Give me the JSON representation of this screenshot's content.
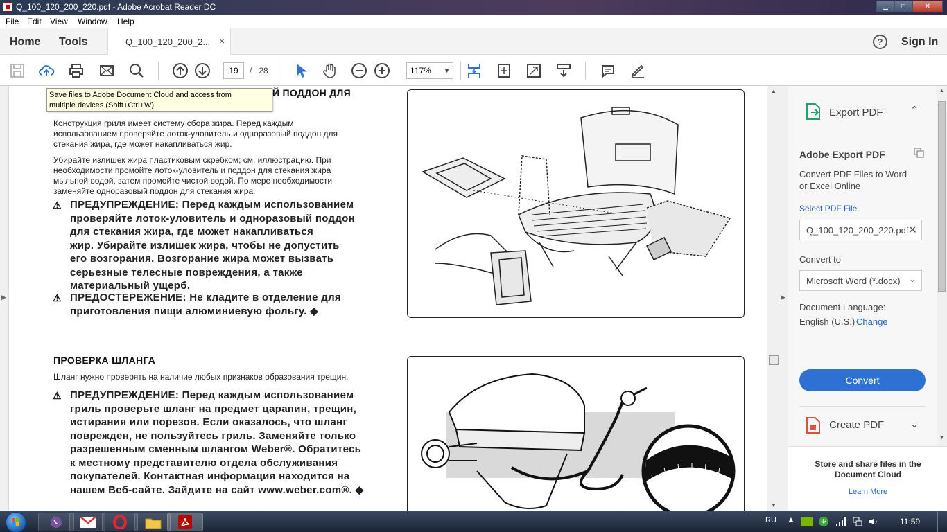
{
  "window": {
    "title": "Q_100_120_200_220.pdf - Adobe Acrobat Reader DC",
    "min": "▁",
    "max": "□",
    "close": "✕"
  },
  "menu": [
    "File",
    "Edit",
    "View",
    "Window",
    "Help"
  ],
  "tabs": {
    "home": "Home",
    "tools": "Tools",
    "document": "Q_100_120_200_2...",
    "close": "×"
  },
  "header": {
    "help": "?",
    "sign_in": "Sign In"
  },
  "toolbar": {
    "page_current": "19",
    "page_sep": "/",
    "page_total": "28",
    "zoom": "117%"
  },
  "tooltip": {
    "line1": "Save files to Adobe Document Cloud and access from",
    "line2": "multiple devices (Shift+Ctrl+W)"
  },
  "doc": {
    "section1": {
      "heading": "Й ПОДДОН ДЛЯ",
      "para1": [
        "Конструкция гриля имеет систему сбора жира. Перед каждым",
        "использованием проверяйте лоток-уловитель и одноразовый поддон для",
        "стекания жира, где может накапливаться жир."
      ],
      "para2": [
        "Убирайте излишек жира пластиковым скребком; см. иллюстрацию. При",
        "необходимости промойте лоток-уловитель и поддон для стекания жира",
        "мыльной водой, затем промойте чистой водой. По мере необходимости",
        "заменяйте одноразовый поддон для стекания жира."
      ],
      "warning": [
        "ПРЕДУПРЕЖДЕНИЕ: Перед каждым использованием",
        "проверяйте лоток-уловитель и одноразовый поддон",
        "для стекания жира, где может накапливаться",
        "жир. Убирайте излишек жира, чтобы не допустить",
        "его возгорания. Возгорание жира может вызвать",
        "серьезные телесные повреждения, а также",
        "материальный ущерб."
      ],
      "caution": [
        "ПРЕДОСТЕРЕЖЕНИЕ: Не кладите в отделение для",
        "приготовления пищи алюминиевую фольгу. ◆"
      ]
    },
    "section2": {
      "heading": "ПРОВЕРКА ШЛАНГА",
      "para1": "Шланг нужно проверять на наличие любых признаков образования трещин.",
      "warning": [
        "ПРЕДУПРЕЖДЕНИЕ: Перед каждым использованием",
        "гриль проверьте шланг на предмет царапин, трещин,",
        "истирания или порезов. Если оказалось, что шланг",
        "поврежден, не пользуйтесь гриль. Заменяйте только",
        "разрешенным сменным шлангом Weber®. Обратитесь",
        "к местному представителю отдела обслуживания",
        "покупателей. Контактная информация находится на",
        "нашем Веб-сайте. Зайдите на сайт www.weber.com®. ◆"
      ]
    }
  },
  "panel": {
    "export_title": "Export PDF",
    "adobe_export": "Adobe Export PDF",
    "desc1": "Convert PDF Files to Word",
    "desc2": "or Excel Online",
    "select_file": "Select PDF File",
    "file_name": "Q_100_120_200_220.pdf",
    "convert_to": "Convert to",
    "format": "Microsoft Word (*.docx)",
    "lang_label": "Document Language:",
    "lang_value": "English (U.S.)",
    "change": "Change",
    "convert": "Convert",
    "create_pdf": "Create PDF",
    "store1": "Store and share files in the",
    "store2": "Document Cloud",
    "learn_more": "Learn More"
  },
  "taskbar": {
    "lang": "RU",
    "time": "11:59"
  },
  "colors": {
    "accent": "#2d72d2",
    "link": "#2563b8",
    "export_icon": "#2a9d6a",
    "create_icon": "#d9533f"
  }
}
